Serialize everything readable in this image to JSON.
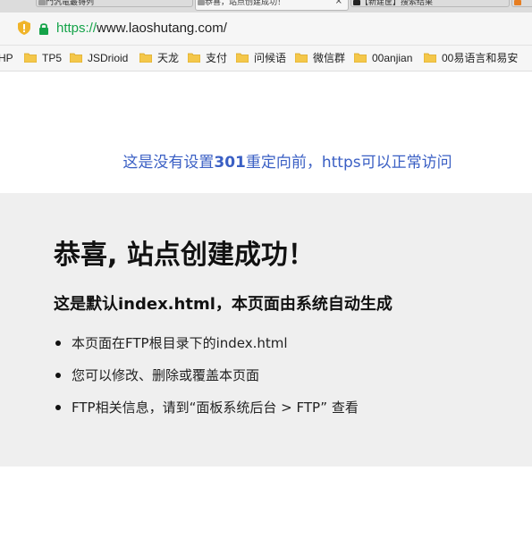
{
  "browser": {
    "tabs": [
      {
        "label": "門汎竜最锝列",
        "active": false
      },
      {
        "label": "恭喜，站点创建成功！",
        "active": true
      },
      {
        "label": "【新建筐】搜索结果",
        "active": false
      }
    ],
    "tab_close_glyph": "×",
    "url_scheme": "https://",
    "url_rest": "www.laoshutang.com/"
  },
  "bookmarks": [
    {
      "label": "HP"
    },
    {
      "label": "TP5"
    },
    {
      "label": "JSDrioid"
    },
    {
      "label": "天龙"
    },
    {
      "label": "支付"
    },
    {
      "label": "问候语"
    },
    {
      "label": "微信群"
    },
    {
      "label": "00anjian"
    },
    {
      "label": "00易语言和易安"
    }
  ],
  "notice": {
    "part1": "这是没有设置",
    "part2": "301",
    "part3": "重定向前，",
    "part4": "https",
    "part5": "可以正常访问"
  },
  "page": {
    "title": "恭喜, 站点创建成功！",
    "subtitle": "这是默认index.html，本页面由系统自动生成",
    "items": [
      "本页面在FTP根目录下的index.html",
      "您可以修改、删除或覆盖本页面",
      "FTP相关信息，请到“面板系统后台 > FTP” 查看"
    ]
  },
  "colors": {
    "notice_text": "#3a5fc4",
    "panel_bg": "#efefef",
    "secure_green": "#15a349",
    "folder_yellow": "#f4c74a"
  },
  "icons": {
    "shield": "shield-icon",
    "lock": "lock-icon",
    "folder": "folder-icon"
  }
}
